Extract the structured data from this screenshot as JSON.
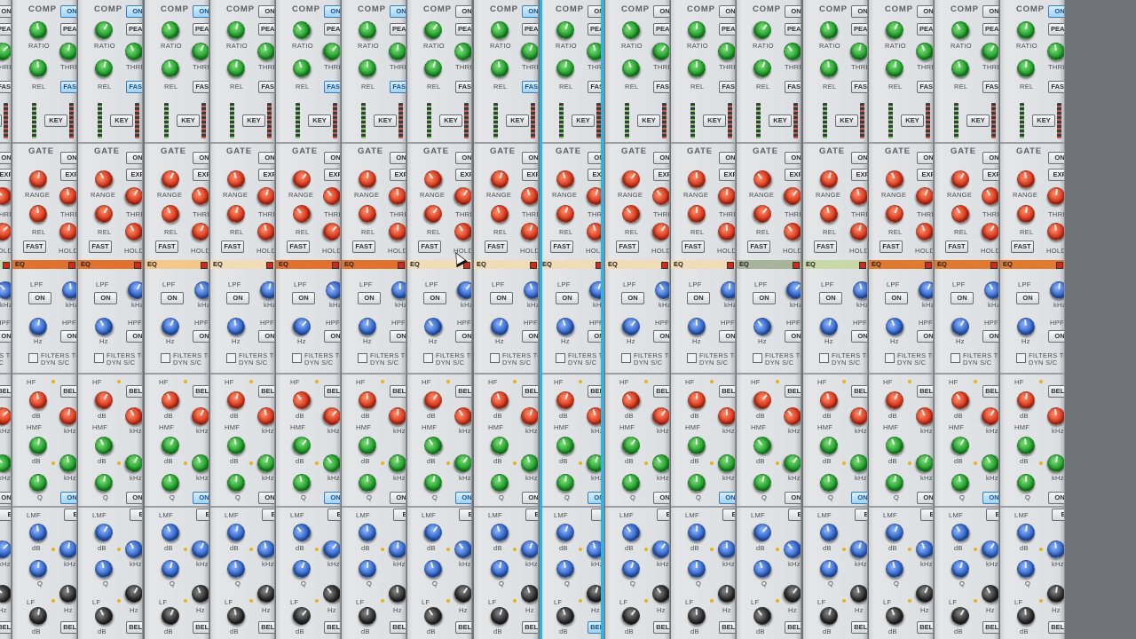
{
  "labels": {
    "comp": "COMP",
    "on": "ON",
    "peak": "PEAK",
    "ratio": "RATIO",
    "thres": "THRES",
    "rel": "REL",
    "fast": "FAST",
    "key": "KEY",
    "gate": "GATE",
    "exp": "EXP",
    "range": "RANGE",
    "hold": "HOLD",
    "eq": "EQ",
    "lpf": "LPF",
    "hpf": "HPF",
    "khz": "kHz",
    "hz": "Hz",
    "filters_to": "FILTERS TO",
    "dyn_sc": "DYN S/C",
    "hf": "HF",
    "bell": "BELL",
    "hmf": "HMF",
    "db": "dB",
    "q": "Q",
    "lmf": "LMF",
    "e": "E",
    "lf": "LF"
  },
  "colors": {
    "selection": "#27b6e8",
    "knob_comp": "green",
    "knob_gate": "red",
    "knob_filter": "blue",
    "knob_hf": "red",
    "knob_hmf": "green",
    "knob_lmf": "blue",
    "knob_lf": "black"
  },
  "channels": [
    {
      "comp_on": false,
      "peak_lit": false,
      "fast_lit": false,
      "eq_color": "#c9d8a8",
      "sel": false,
      "lf_bell_lit": false
    },
    {
      "comp_on": true,
      "peak_lit": false,
      "fast_lit": true,
      "eq_color": "#e0722e",
      "sel": false,
      "lf_bell_lit": false
    },
    {
      "comp_on": true,
      "peak_lit": false,
      "fast_lit": true,
      "eq_color": "#e0722e",
      "sel": false,
      "lf_bell_lit": false
    },
    {
      "comp_on": true,
      "peak_lit": false,
      "fast_lit": false,
      "eq_color": "#f4c88a",
      "sel": false,
      "lf_bell_lit": false
    },
    {
      "comp_on": false,
      "peak_lit": false,
      "fast_lit": false,
      "eq_color": "#f2dcb8",
      "sel": false,
      "lf_bell_lit": false
    },
    {
      "comp_on": true,
      "peak_lit": false,
      "fast_lit": true,
      "eq_color": "#e0722e",
      "sel": false,
      "lf_bell_lit": false
    },
    {
      "comp_on": true,
      "peak_lit": false,
      "fast_lit": true,
      "eq_color": "#e0722e",
      "sel": false,
      "lf_bell_lit": false
    },
    {
      "comp_on": false,
      "peak_lit": false,
      "fast_lit": false,
      "eq_color": "#f2dcb8",
      "sel": false,
      "lf_bell_lit": false
    },
    {
      "comp_on": true,
      "peak_lit": false,
      "fast_lit": true,
      "eq_color": "#f2dcb8",
      "sel": false,
      "lf_bell_lit": false
    },
    {
      "comp_on": false,
      "peak_lit": false,
      "fast_lit": false,
      "eq_color": "#f2dcb8",
      "sel": true,
      "lf_bell_lit": true
    },
    {
      "comp_on": false,
      "peak_lit": false,
      "fast_lit": false,
      "eq_color": "#f2dcb8",
      "sel": false,
      "lf_bell_lit": false
    },
    {
      "comp_on": false,
      "peak_lit": false,
      "fast_lit": false,
      "eq_color": "#f2dcb8",
      "sel": false,
      "lf_bell_lit": false
    },
    {
      "comp_on": false,
      "peak_lit": false,
      "fast_lit": false,
      "eq_color": "#a8b49a",
      "sel": false,
      "lf_bell_lit": false
    },
    {
      "comp_on": false,
      "peak_lit": false,
      "fast_lit": false,
      "eq_color": "#c9d8a8",
      "sel": false,
      "lf_bell_lit": false
    },
    {
      "comp_on": false,
      "peak_lit": false,
      "fast_lit": false,
      "eq_color": "#e07a2e",
      "sel": false,
      "lf_bell_lit": false
    },
    {
      "comp_on": false,
      "peak_lit": false,
      "fast_lit": false,
      "eq_color": "#e07a2e",
      "sel": false,
      "lf_bell_lit": false
    },
    {
      "comp_on": true,
      "peak_lit": false,
      "fast_lit": false,
      "eq_color": "#e07a2e",
      "sel": false,
      "lf_bell_lit": false
    }
  ]
}
